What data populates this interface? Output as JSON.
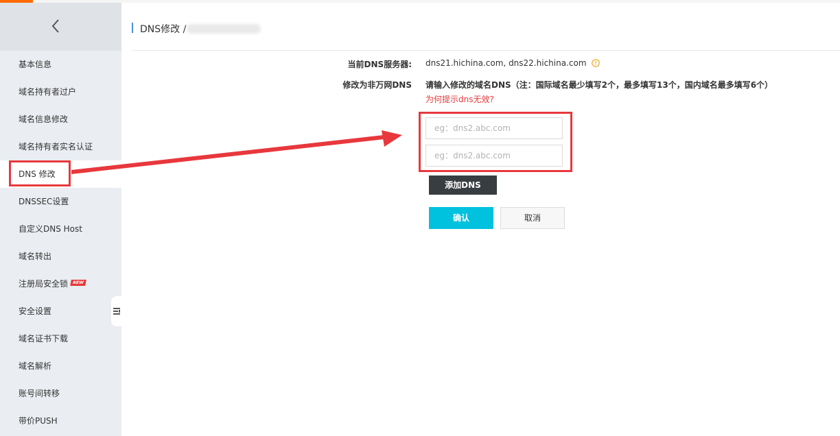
{
  "sidebar": {
    "items": [
      {
        "label": "基本信息"
      },
      {
        "label": "域名持有者过户"
      },
      {
        "label": "域名信息修改"
      },
      {
        "label": "域名持有者实名认证"
      },
      {
        "label": "DNS 修改",
        "active": true
      },
      {
        "label": "DNSSEC设置"
      },
      {
        "label": "自定义DNS Host"
      },
      {
        "label": "域名转出"
      },
      {
        "label": "注册局安全锁",
        "badge": "NEW"
      },
      {
        "label": "安全设置"
      },
      {
        "label": "域名证书下载"
      },
      {
        "label": "域名解析"
      },
      {
        "label": "账号间转移"
      },
      {
        "label": "带价PUSH"
      }
    ]
  },
  "header": {
    "title": "DNS修改 /"
  },
  "form": {
    "current_dns_label": "当前DNS服务器:",
    "current_dns_value": "dns21.hichina.com, dns22.hichina.com",
    "modify_label": "修改为非万网DNS",
    "hint_text": "请输入修改的域名DNS（注：国际域名最少填写2个，最多填写13个，国内域名最多填写6个）",
    "invalid_link": "为何提示dns无效?",
    "inputs": [
      {
        "value": "",
        "placeholder": "eg：dns2.abc.com"
      },
      {
        "value": "",
        "placeholder": "eg：dns2.abc.com"
      }
    ],
    "add_button": "添加DNS",
    "confirm_button": "确认",
    "cancel_button": "取消"
  },
  "colors": {
    "accent": "#ff6a00",
    "annotation": "#e8383d",
    "confirm": "#00c1de",
    "add_button": "#373d41",
    "warning": "#f5a623"
  },
  "icons": [
    "chevron-left-icon",
    "warning-icon",
    "collapse-sidebar-icon",
    "annotation-arrow"
  ]
}
